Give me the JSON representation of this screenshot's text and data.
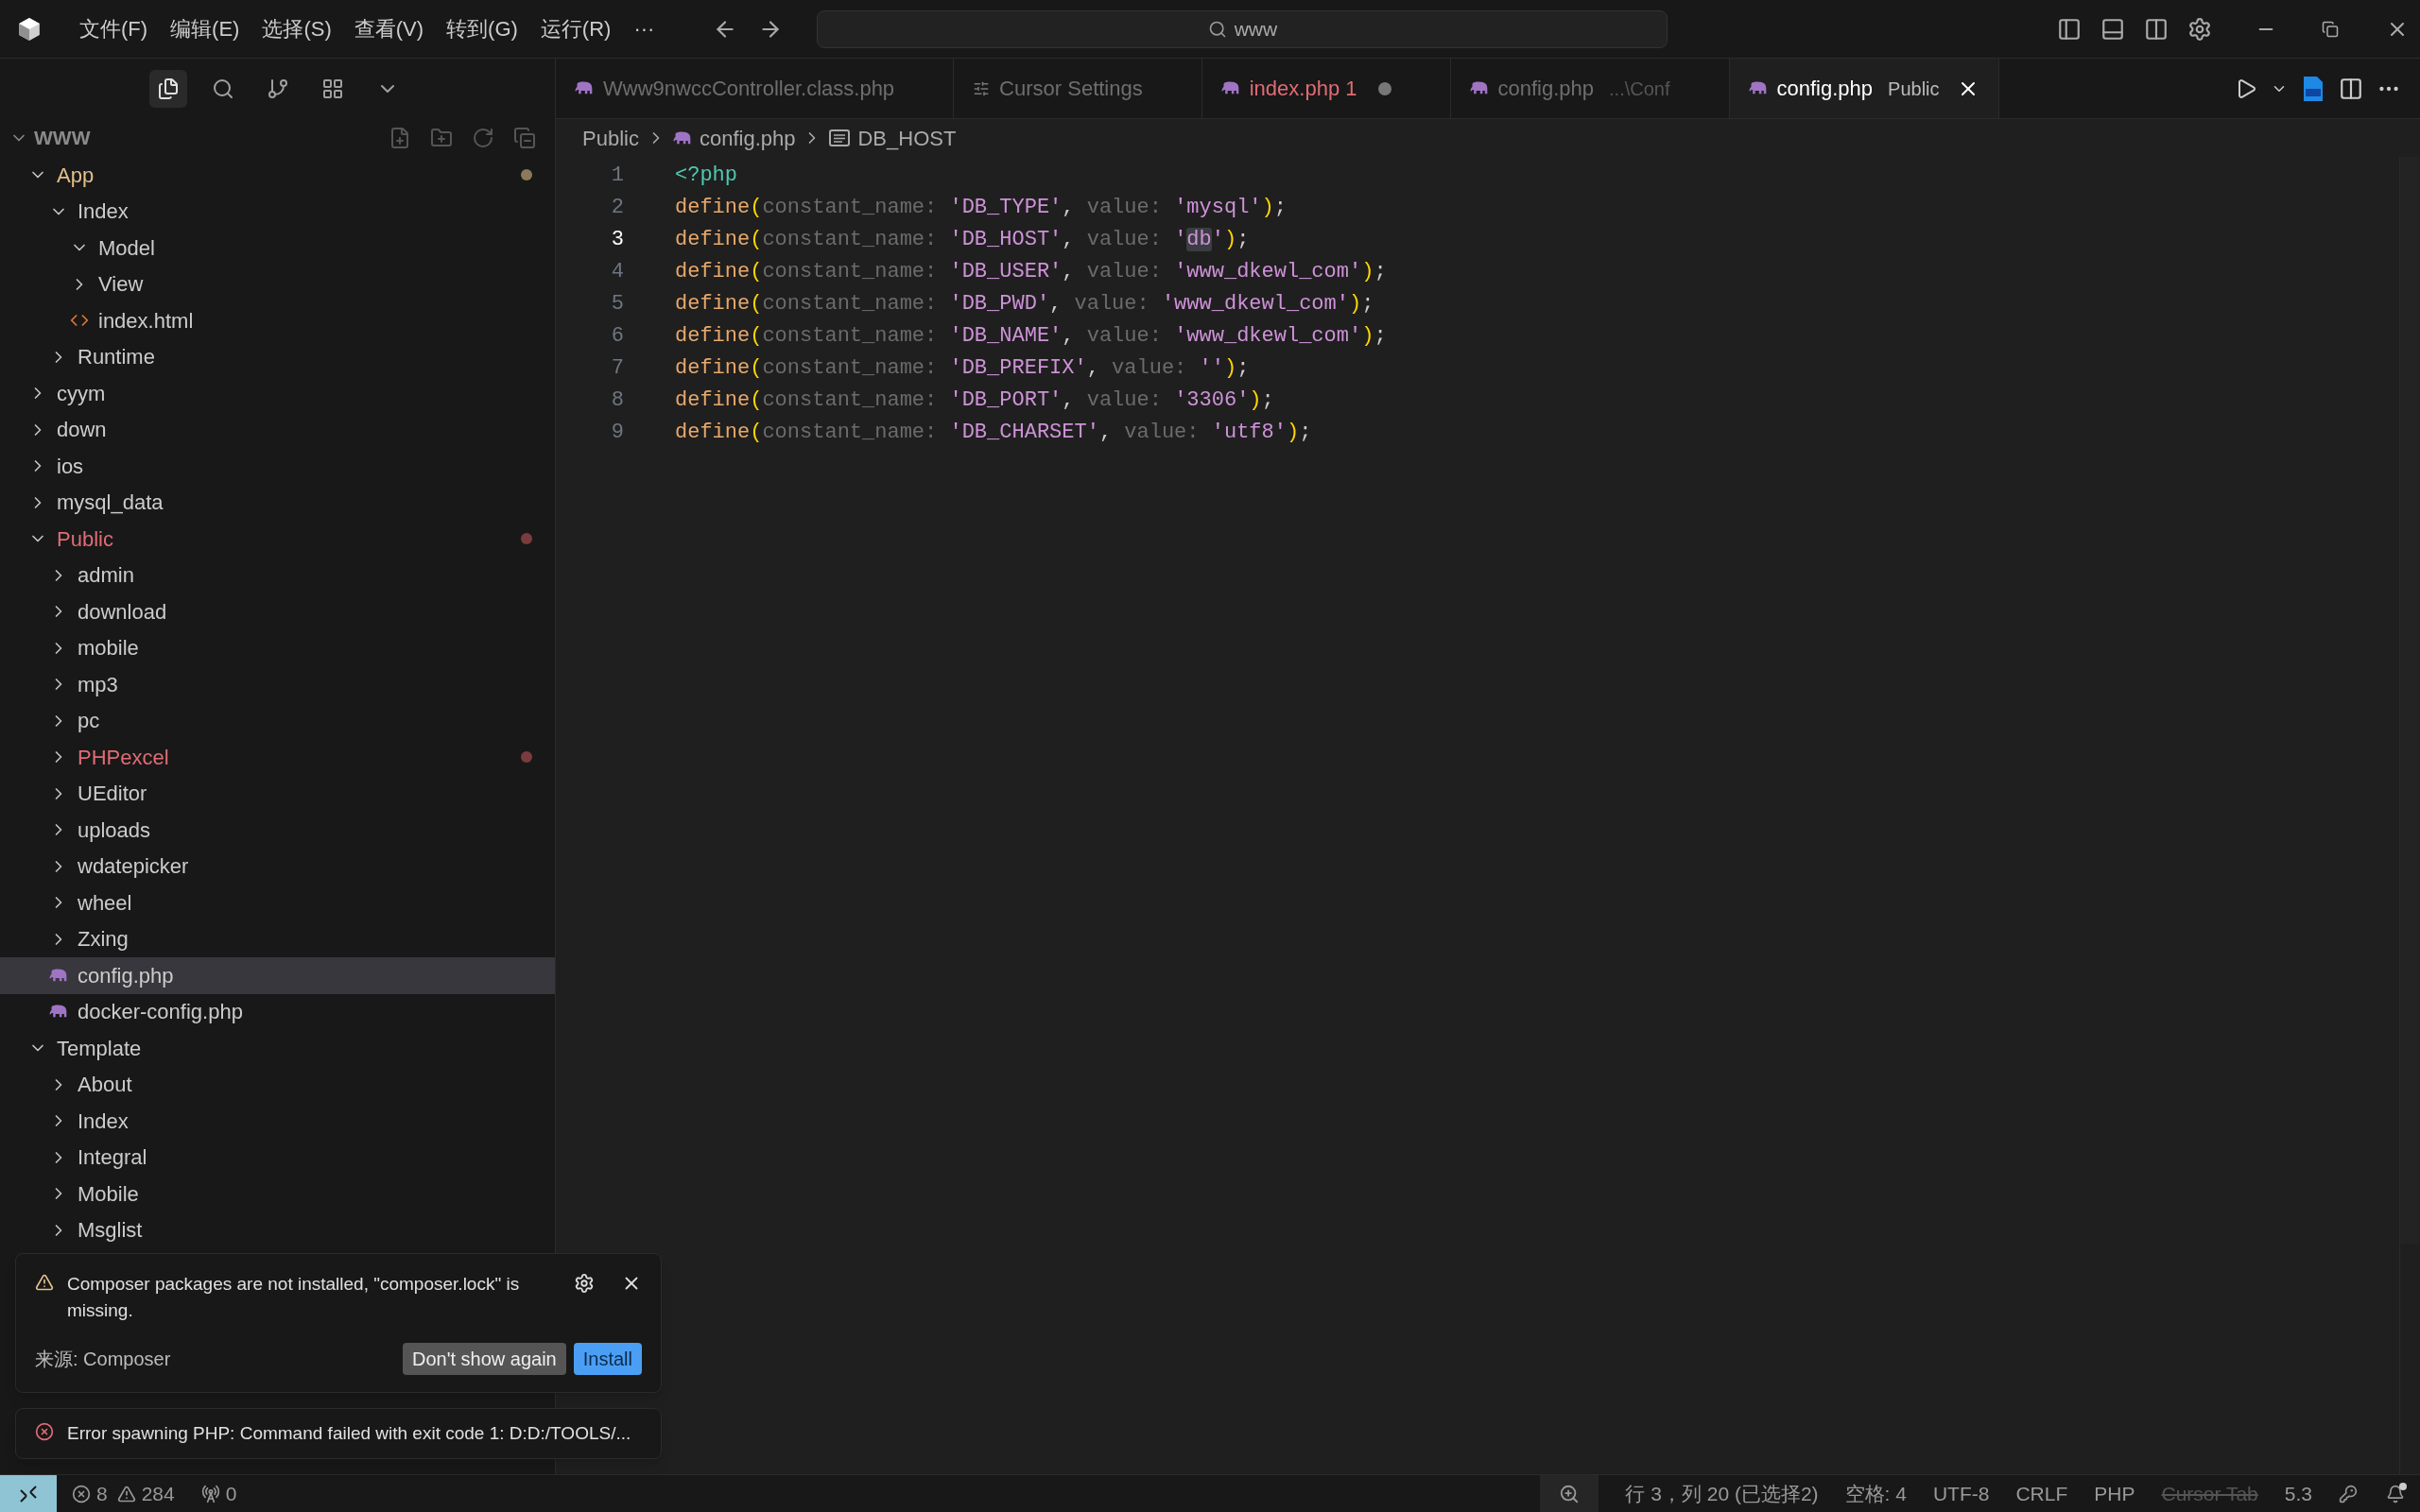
{
  "menu": [
    "文件(F)",
    "编辑(E)",
    "选择(S)",
    "查看(V)",
    "转到(G)",
    "运行(R)",
    "···"
  ],
  "search": {
    "value": "www"
  },
  "activity": [
    {
      "kind": "files",
      "selected": true
    },
    {
      "kind": "search",
      "selected": false
    },
    {
      "kind": "scm",
      "selected": false
    },
    {
      "kind": "extensions",
      "selected": false
    },
    {
      "kind": "more",
      "selected": false
    }
  ],
  "explorer": {
    "root": "WWW",
    "expanded": true,
    "items": [
      {
        "name": "App",
        "kind": "folder",
        "expanded": true,
        "modified": true,
        "children": [
          {
            "name": "Index",
            "kind": "folder",
            "expanded": true,
            "children": [
              {
                "name": "Model",
                "kind": "folder",
                "expanded": true
              },
              {
                "name": "View",
                "kind": "folder",
                "expanded": false
              },
              {
                "name": "index.html",
                "kind": "html"
              }
            ]
          },
          {
            "name": "Runtime",
            "kind": "folder",
            "expanded": false
          }
        ]
      },
      {
        "name": "cyym",
        "kind": "folder",
        "expanded": false
      },
      {
        "name": "down",
        "kind": "folder",
        "expanded": false
      },
      {
        "name": "ios",
        "kind": "folder",
        "expanded": false
      },
      {
        "name": "mysql_data",
        "kind": "folder",
        "expanded": false
      },
      {
        "name": "Public",
        "kind": "folder",
        "expanded": true,
        "problems": true,
        "children": [
          {
            "name": "admin",
            "kind": "folder",
            "expanded": false
          },
          {
            "name": "download",
            "kind": "folder",
            "expanded": false
          },
          {
            "name": "mobile",
            "kind": "folder",
            "expanded": false
          },
          {
            "name": "mp3",
            "kind": "folder",
            "expanded": false
          },
          {
            "name": "pc",
            "kind": "folder",
            "expanded": false
          },
          {
            "name": "PHPexcel",
            "kind": "folder",
            "expanded": false,
            "problems": true
          },
          {
            "name": "UEditor",
            "kind": "folder",
            "expanded": false
          },
          {
            "name": "uploads",
            "kind": "folder",
            "expanded": false
          },
          {
            "name": "wdatepicker",
            "kind": "folder",
            "expanded": false
          },
          {
            "name": "wheel",
            "kind": "folder",
            "expanded": false
          },
          {
            "name": "Zxing",
            "kind": "folder",
            "expanded": false
          },
          {
            "name": "config.php",
            "kind": "php",
            "selected": true
          },
          {
            "name": "docker-config.php",
            "kind": "php",
            "selected": false
          }
        ]
      },
      {
        "name": "Template",
        "kind": "folder",
        "expanded": true,
        "children": [
          {
            "name": "About",
            "kind": "folder",
            "expanded": false
          },
          {
            "name": "Index",
            "kind": "folder",
            "expanded": false
          },
          {
            "name": "Integral",
            "kind": "folder",
            "expanded": false
          },
          {
            "name": "Mobile",
            "kind": "folder",
            "expanded": false
          },
          {
            "name": "Msglist",
            "kind": "folder",
            "expanded": false
          }
        ]
      }
    ]
  },
  "tabs": [
    {
      "label": "Www9nwccController.class.php",
      "kind": "php",
      "selected": false,
      "problems": false,
      "unsaved": false
    },
    {
      "label": "Cursor Settings",
      "kind": "settings",
      "selected": false,
      "problems": false,
      "unsaved": false
    },
    {
      "label": "index.php 1",
      "kind": "php",
      "selected": false,
      "problems": true,
      "unsaved": true
    },
    {
      "label": "config.php",
      "detail": "...\\Conf",
      "kind": "php",
      "selected": false,
      "problems": false,
      "unsaved": false
    },
    {
      "label": "config.php",
      "detail": "Public",
      "kind": "php",
      "selected": true,
      "problems": false,
      "unsaved": false
    }
  ],
  "breadcrumbs": [
    {
      "label": "Public",
      "kind": "folder"
    },
    {
      "label": "config.php",
      "kind": "php"
    },
    {
      "label": "DB_HOST",
      "kind": "symbol"
    }
  ],
  "code": [
    {
      "number": "1",
      "current": false,
      "tokens": [
        {
          "kind": "tag",
          "t": "<?php"
        }
      ]
    },
    {
      "number": "2",
      "current": false,
      "tokens": [
        {
          "kind": "fn",
          "t": "define"
        },
        {
          "kind": "paren",
          "t": "("
        },
        {
          "kind": "hint",
          "t": "constant_name:"
        },
        {
          "kind": "str",
          "t": "'DB_TYPE'"
        },
        {
          "kind": "plain",
          "t": ", "
        },
        {
          "kind": "hint",
          "t": "value:"
        },
        {
          "kind": "str",
          "t": "'mysql'"
        },
        {
          "kind": "paren",
          "t": ")"
        },
        {
          "kind": "plain",
          "t": ";"
        }
      ]
    },
    {
      "number": "3",
      "current": true,
      "tokens": [
        {
          "kind": "fn",
          "t": "define"
        },
        {
          "kind": "paren",
          "t": "("
        },
        {
          "kind": "hint",
          "t": "constant_name:"
        },
        {
          "kind": "str",
          "t": "'DB_HOST'"
        },
        {
          "kind": "plain",
          "t": ", "
        },
        {
          "kind": "hint",
          "t": "value:"
        },
        {
          "kind": "str",
          "t": "'"
        },
        {
          "kind": "sel",
          "t": "db"
        },
        {
          "kind": "str",
          "t": "'"
        },
        {
          "kind": "paren",
          "t": ")"
        },
        {
          "kind": "plain",
          "t": ";"
        }
      ]
    },
    {
      "number": "4",
      "current": false,
      "tokens": [
        {
          "kind": "fn",
          "t": "define"
        },
        {
          "kind": "paren",
          "t": "("
        },
        {
          "kind": "hint",
          "t": "constant_name:"
        },
        {
          "kind": "str",
          "t": "'DB_USER'"
        },
        {
          "kind": "plain",
          "t": ", "
        },
        {
          "kind": "hint",
          "t": "value:"
        },
        {
          "kind": "str",
          "t": "'www_dkewl_com'"
        },
        {
          "kind": "paren",
          "t": ")"
        },
        {
          "kind": "plain",
          "t": ";"
        }
      ]
    },
    {
      "number": "5",
      "current": false,
      "tokens": [
        {
          "kind": "fn",
          "t": "define"
        },
        {
          "kind": "paren",
          "t": "("
        },
        {
          "kind": "hint",
          "t": "constant_name:"
        },
        {
          "kind": "str",
          "t": "'DB_PWD'"
        },
        {
          "kind": "plain",
          "t": ", "
        },
        {
          "kind": "hint",
          "t": "value:"
        },
        {
          "kind": "str",
          "t": "'www_dkewl_com'"
        },
        {
          "kind": "paren",
          "t": ")"
        },
        {
          "kind": "plain",
          "t": ";"
        }
      ]
    },
    {
      "number": "6",
      "current": false,
      "tokens": [
        {
          "kind": "fn",
          "t": "define"
        },
        {
          "kind": "paren",
          "t": "("
        },
        {
          "kind": "hint",
          "t": "constant_name:"
        },
        {
          "kind": "str",
          "t": "'DB_NAME'"
        },
        {
          "kind": "plain",
          "t": ", "
        },
        {
          "kind": "hint",
          "t": "value:"
        },
        {
          "kind": "str",
          "t": "'www_dkewl_com'"
        },
        {
          "kind": "paren",
          "t": ")"
        },
        {
          "kind": "plain",
          "t": ";"
        }
      ]
    },
    {
      "number": "7",
      "current": false,
      "tokens": [
        {
          "kind": "fn",
          "t": "define"
        },
        {
          "kind": "paren",
          "t": "("
        },
        {
          "kind": "hint",
          "t": "constant_name:"
        },
        {
          "kind": "str",
          "t": "'DB_PREFIX'"
        },
        {
          "kind": "plain",
          "t": ", "
        },
        {
          "kind": "hint",
          "t": "value:"
        },
        {
          "kind": "str",
          "t": "''"
        },
        {
          "kind": "paren",
          "t": ")"
        },
        {
          "kind": "plain",
          "t": ";"
        }
      ]
    },
    {
      "number": "8",
      "current": false,
      "tokens": [
        {
          "kind": "fn",
          "t": "define"
        },
        {
          "kind": "paren",
          "t": "("
        },
        {
          "kind": "hint",
          "t": "constant_name:"
        },
        {
          "kind": "str",
          "t": "'DB_PORT'"
        },
        {
          "kind": "plain",
          "t": ", "
        },
        {
          "kind": "hint",
          "t": "value:"
        },
        {
          "kind": "str",
          "t": "'3306'"
        },
        {
          "kind": "paren",
          "t": ")"
        },
        {
          "kind": "plain",
          "t": ";"
        }
      ]
    },
    {
      "number": "9",
      "current": false,
      "tokens": [
        {
          "kind": "fn",
          "t": "define"
        },
        {
          "kind": "paren",
          "t": "("
        },
        {
          "kind": "hint",
          "t": "constant_name:"
        },
        {
          "kind": "str",
          "t": "'DB_CHARSET'"
        },
        {
          "kind": "plain",
          "t": ", "
        },
        {
          "kind": "hint",
          "t": "value:"
        },
        {
          "kind": "str",
          "t": "'utf8'"
        },
        {
          "kind": "paren",
          "t": ")"
        },
        {
          "kind": "plain",
          "t": ";"
        }
      ]
    }
  ],
  "notifications": [
    {
      "kind": "warning",
      "message": "Composer packages are not installed, \"composer.lock\" is missing.",
      "source": "来源: Composer",
      "buttons": [
        {
          "label": "Don't show again",
          "primary": false
        },
        {
          "label": "Install",
          "primary": true
        }
      ]
    },
    {
      "kind": "error",
      "message": "Error spawning PHP: Command failed with exit code 1: D:D:/TOOLS/..."
    }
  ],
  "status_bar": {
    "errors": "8",
    "warnings": "284",
    "ports": "0",
    "right": [
      {
        "kind": "zoom"
      },
      {
        "kind": "text",
        "label": "行 3，列 20 (已选择2)",
        "disabled": false
      },
      {
        "kind": "text",
        "label": "空格: 4",
        "disabled": false
      },
      {
        "kind": "text",
        "label": "UTF-8",
        "disabled": false
      },
      {
        "kind": "text",
        "label": "CRLF",
        "disabled": false
      },
      {
        "kind": "text",
        "label": "PHP",
        "disabled": false
      },
      {
        "kind": "text",
        "label": "Cursor Tab",
        "disabled": true
      },
      {
        "kind": "text",
        "label": "5.3",
        "disabled": false
      },
      {
        "kind": "key"
      },
      {
        "kind": "bell"
      }
    ]
  }
}
